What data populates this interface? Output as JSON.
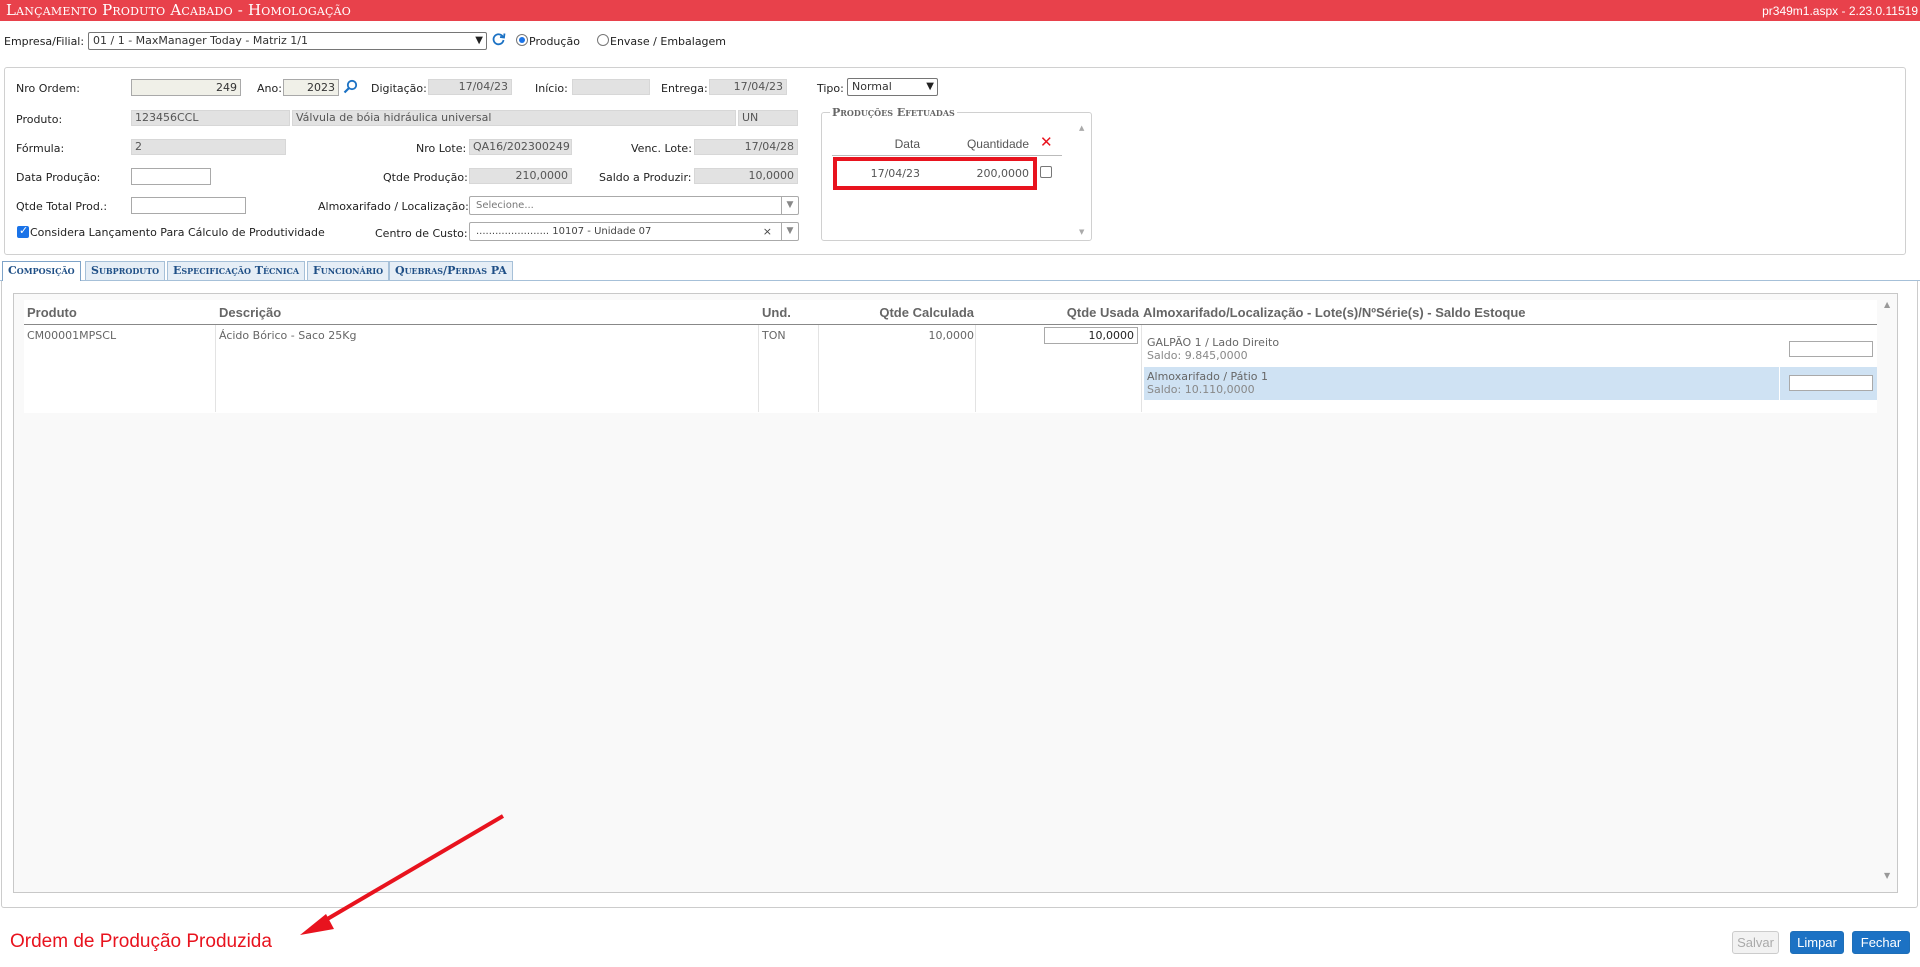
{
  "header": {
    "title": "Lançamento Produto Acabado  - Homologação",
    "version": "pr349m1.aspx - 2.23.0.11519"
  },
  "top": {
    "empresa_label": "Empresa/Filial:",
    "empresa_value": "01 / 1 - MaxManager Today - Matriz 1/1",
    "radio_producao": "Produção",
    "radio_envase": "Envase / Embalagem"
  },
  "form": {
    "nro_ordem_label": "Nro Ordem:",
    "nro_ordem": "249",
    "ano_label": "Ano:",
    "ano": "2023",
    "digitacao_label": "Digitação:",
    "digitacao": "17/04/23",
    "inicio_label": "Início:",
    "inicio": "",
    "entrega_label": "Entrega:",
    "entrega": "17/04/23",
    "tipo_label": "Tipo:",
    "tipo": "Normal",
    "produto_label": "Produto:",
    "produto_codigo": "123456CCL",
    "produto_desc": "Válvula de bóia hidráulica universal",
    "produto_un": "UN",
    "formula_label": "Fórmula:",
    "formula": "2",
    "nro_lote_label": "Nro Lote:",
    "nro_lote": "QA16/202300249",
    "venc_lote_label": "Venc. Lote:",
    "venc_lote": "17/04/28",
    "data_producao_label": "Data Produção:",
    "data_producao": "",
    "qtde_producao_label": "Qtde Produção:",
    "qtde_producao": "210,0000",
    "saldo_label": "Saldo a Produzir:",
    "saldo": "10,0000",
    "qtde_total_label": "Qtde Total Prod.:",
    "qtde_total": "",
    "almox_label": "Almoxarifado / Localização:",
    "almox_placeholder": "Selecione...",
    "considera_label": "Considera Lançamento Para Cálculo de Produtividade",
    "centro_label": "Centro de Custo:",
    "centro_value": "....................... 10107 - Unidade 07"
  },
  "producoes": {
    "legend": "Produções Efetuadas",
    "col_data": "Data",
    "col_qtd": "Quantidade",
    "rows": [
      {
        "data": "17/04/23",
        "qtd": "200,0000"
      }
    ]
  },
  "tabs": [
    "Composição",
    "Subproduto",
    "Especificação Técnica",
    "Funcionário",
    "Quebras/Perdas PA"
  ],
  "grid": {
    "headers": {
      "produto": "Produto",
      "descricao": "Descrição",
      "und": "Und.",
      "qtde_calc": "Qtde Calculada",
      "qtde_usada": "Qtde Usada",
      "almox": "Almoxarifado/Localização - Lote(s)/NºSérie(s) - Saldo Estoque"
    },
    "row": {
      "produto": "CM00001MPSCL",
      "descricao": "Ácido Bórico - Saco 25Kg",
      "und": "TON",
      "qtde_calc": "10,0000",
      "qtde_usada": "10,0000",
      "locs": [
        {
          "name": "GALPÃO 1 / Lado Direito",
          "saldo": "Saldo: 9.845,0000"
        },
        {
          "name": "Almoxarifado / Pátio 1",
          "saldo": "Saldo: 10.110,0000"
        }
      ]
    }
  },
  "annotation": "Ordem de Produção Produzida",
  "buttons": {
    "salvar": "Salvar",
    "limpar": "Limpar",
    "fechar": "Fechar"
  },
  "colors": {
    "titlebar": "#e8414b",
    "accent": "#1c72c4",
    "annotation": "#e8131e",
    "highlight_row": "#cfe2f3"
  }
}
